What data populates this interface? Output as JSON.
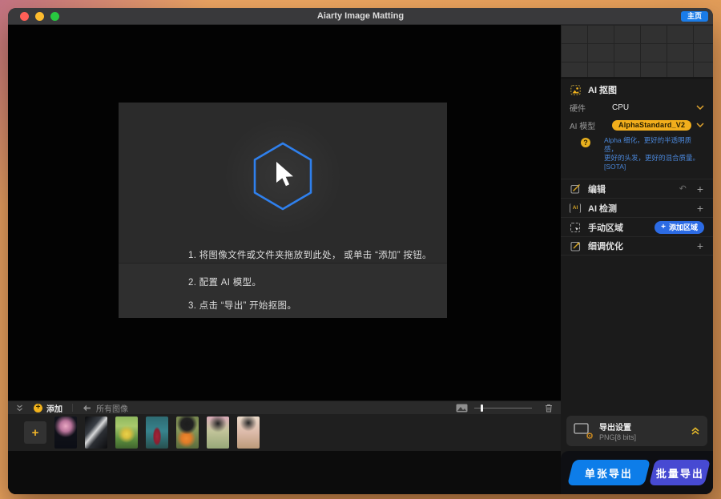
{
  "titlebar": {
    "title": "Aiarty Image Matting",
    "home_button": "主页"
  },
  "dropzone": {
    "instruction_1": "1. 将图像文件或文件夹拖放到此处， 或单击 “添加” 按钮。",
    "instruction_2": "2. 配置 AI 模型。",
    "instruction_3": "3. 点击 “导出” 开始抠图。"
  },
  "toolbar": {
    "add_label": "添加",
    "all_images_label": "所有图像"
  },
  "thumbnails": [
    {
      "name": "jellyfish"
    },
    {
      "name": "metallic-eagle"
    },
    {
      "name": "yellow-bicycle-park"
    },
    {
      "name": "woman-red-dress-forest"
    },
    {
      "name": "woman-orange-flowers"
    },
    {
      "name": "woman-pink-garden"
    },
    {
      "name": "woman-beige-flowers"
    }
  ],
  "sidebar": {
    "matting": {
      "title": "AI 抠图",
      "hardware_label": "硬件",
      "hardware_value": "CPU",
      "model_label": "AI 模型",
      "model_value": "AlphaStandard_V2",
      "hint_line1": "Alpha 细化，更好的半透明质感，",
      "hint_line2": "更好的头发，更好的混合质量。[SOTA]"
    },
    "edit_panel": {
      "label": "编辑"
    },
    "detect_panel": {
      "label": "AI 检测",
      "icon_text": "AI"
    },
    "manual_panel": {
      "label": "手动区域",
      "add_region_button": "添加区域"
    },
    "finetune_panel": {
      "label": "细调优化"
    },
    "export": {
      "title": "导出设置",
      "format": "PNG[8 bits]"
    },
    "actions": {
      "single_export": "单张导出",
      "batch_export": "批量导出"
    }
  },
  "icons": {
    "plus": "+",
    "question": "?",
    "undo": "↶",
    "crosshair": "+",
    "gear": "⚙"
  },
  "colors": {
    "accent_blue": "#0d7de9",
    "accent_indigo": "#474ad2",
    "accent_yellow": "#f2ae1c",
    "hint_blue": "#4a86d8",
    "hexagon_blue": "#2f80ed"
  }
}
